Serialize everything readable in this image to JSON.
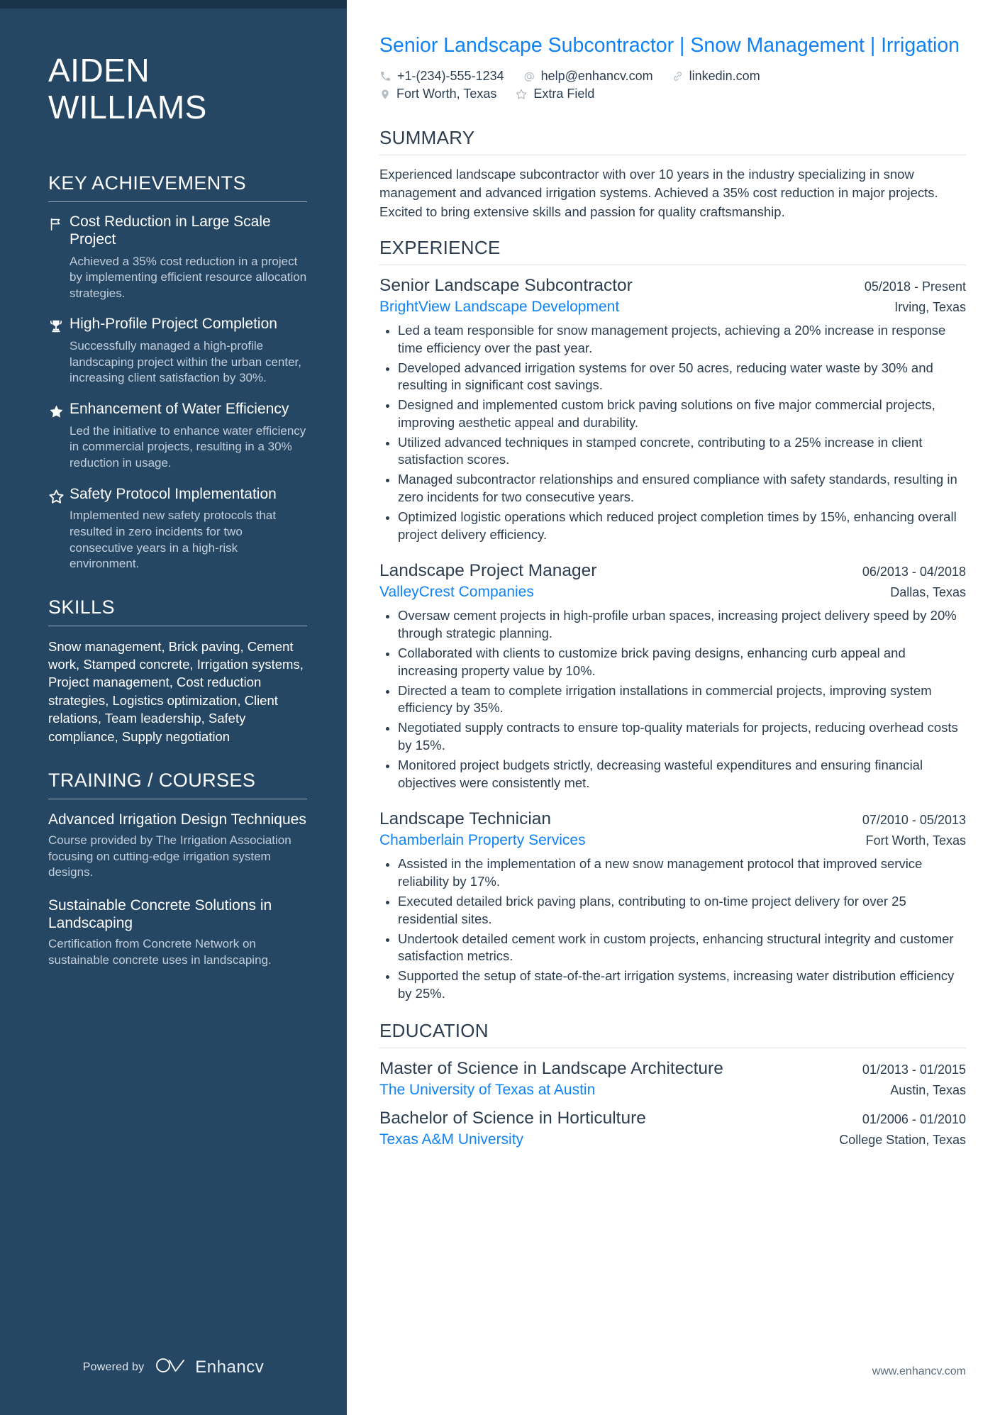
{
  "sidebar": {
    "name_first": "AIDEN",
    "name_last": "WILLIAMS",
    "achievements_heading": "KEY ACHIEVEMENTS",
    "achievements": [
      {
        "icon": "flag-icon",
        "title": "Cost Reduction in Large Scale Project",
        "desc": "Achieved a 35% cost reduction in a project by implementing efficient resource allocation strategies."
      },
      {
        "icon": "trophy-icon",
        "title": "High-Profile Project Completion",
        "desc": "Successfully managed a high-profile landscaping project within the urban center, increasing client satisfaction by 30%."
      },
      {
        "icon": "star-filled-icon",
        "title": "Enhancement of Water Efficiency",
        "desc": "Led the initiative to enhance water efficiency in commercial projects, resulting in a 30% reduction in usage."
      },
      {
        "icon": "star-outline-icon",
        "title": "Safety Protocol Implementation",
        "desc": "Implemented new safety protocols that resulted in zero incidents for two consecutive years in a high-risk environment."
      }
    ],
    "skills_heading": "SKILLS",
    "skills_text": "Snow management, Brick paving, Cement work, Stamped concrete, Irrigation systems, Project management, Cost reduction strategies, Logistics optimization, Client relations, Team leadership, Safety compliance, Supply negotiation",
    "training_heading": "TRAINING / COURSES",
    "courses": [
      {
        "title": "Advanced Irrigation Design Techniques",
        "desc": "Course provided by The Irrigation Association focusing on cutting-edge irrigation system designs."
      },
      {
        "title": "Sustainable Concrete Solutions in Landscaping",
        "desc": "Certification from Concrete Network on sustainable concrete uses in landscaping."
      }
    ],
    "powered_by": "Powered by",
    "brand": "Enhancv"
  },
  "main": {
    "headline": "Senior Landscape Subcontractor | Snow Management | Irrigation",
    "contacts_row1": [
      {
        "icon": "phone-icon",
        "text": "+1-(234)-555-1234"
      },
      {
        "icon": "at-icon",
        "text": "help@enhancv.com"
      },
      {
        "icon": "link-icon",
        "text": "linkedin.com"
      }
    ],
    "contacts_row2": [
      {
        "icon": "location-pin-icon",
        "text": "Fort Worth, Texas"
      },
      {
        "icon": "star-outline-icon",
        "text": "Extra Field"
      }
    ],
    "summary_heading": "SUMMARY",
    "summary_text": "Experienced landscape subcontractor with over 10 years in the industry specializing in snow management and advanced irrigation systems. Achieved a 35% cost reduction in major projects. Excited to bring extensive skills and passion for quality craftsmanship.",
    "experience_heading": "EXPERIENCE",
    "experience": [
      {
        "title": "Senior Landscape Subcontractor",
        "date": "05/2018 - Present",
        "org": "BrightView Landscape Development",
        "location": "Irving, Texas",
        "bullets": [
          "Led a team responsible for snow management projects, achieving a 20% increase in response time efficiency over the past year.",
          "Developed advanced irrigation systems for over 50 acres, reducing water waste by 30% and resulting in significant cost savings.",
          "Designed and implemented custom brick paving solutions on five major commercial projects, improving aesthetic appeal and durability.",
          "Utilized advanced techniques in stamped concrete, contributing to a 25% increase in client satisfaction scores.",
          "Managed subcontractor relationships and ensured compliance with safety standards, resulting in zero incidents for two consecutive years.",
          "Optimized logistic operations which reduced project completion times by 15%, enhancing overall project delivery efficiency."
        ]
      },
      {
        "title": "Landscape Project Manager",
        "date": "06/2013 - 04/2018",
        "org": "ValleyCrest Companies",
        "location": "Dallas, Texas",
        "bullets": [
          "Oversaw cement projects in high-profile urban spaces, increasing project delivery speed by 20% through strategic planning.",
          "Collaborated with clients to customize brick paving designs, enhancing curb appeal and increasing property value by 10%.",
          "Directed a team to complete irrigation installations in commercial projects, improving system efficiency by 35%.",
          "Negotiated supply contracts to ensure top-quality materials for projects, reducing overhead costs by 15%.",
          "Monitored project budgets strictly, decreasing wasteful expenditures and ensuring financial objectives were consistently met."
        ]
      },
      {
        "title": "Landscape Technician",
        "date": "07/2010 - 05/2013",
        "org": "Chamberlain Property Services",
        "location": "Fort Worth, Texas",
        "bullets": [
          "Assisted in the implementation of a new snow management protocol that improved service reliability by 17%.",
          "Executed detailed brick paving plans, contributing to on-time project delivery for over 25 residential sites.",
          "Undertook detailed cement work in custom projects, enhancing structural integrity and customer satisfaction metrics.",
          "Supported the setup of state-of-the-art irrigation systems, increasing water distribution efficiency by 25%."
        ]
      }
    ],
    "education_heading": "EDUCATION",
    "education": [
      {
        "title": "Master of Science in Landscape Architecture",
        "date": "01/2013 - 01/2015",
        "org": "The University of Texas at Austin",
        "location": "Austin, Texas"
      },
      {
        "title": "Bachelor of Science in Horticulture",
        "date": "01/2006 - 01/2010",
        "org": "Texas A&M University",
        "location": "College Station, Texas"
      }
    ],
    "website": "www.enhancv.com"
  },
  "colors": {
    "sidebar_bg": "#254764",
    "sidebar_top_bar": "#1b3349",
    "accent_blue": "#0f83f5",
    "body_text": "#2b3d4f",
    "muted_text": "#c3cedb"
  }
}
